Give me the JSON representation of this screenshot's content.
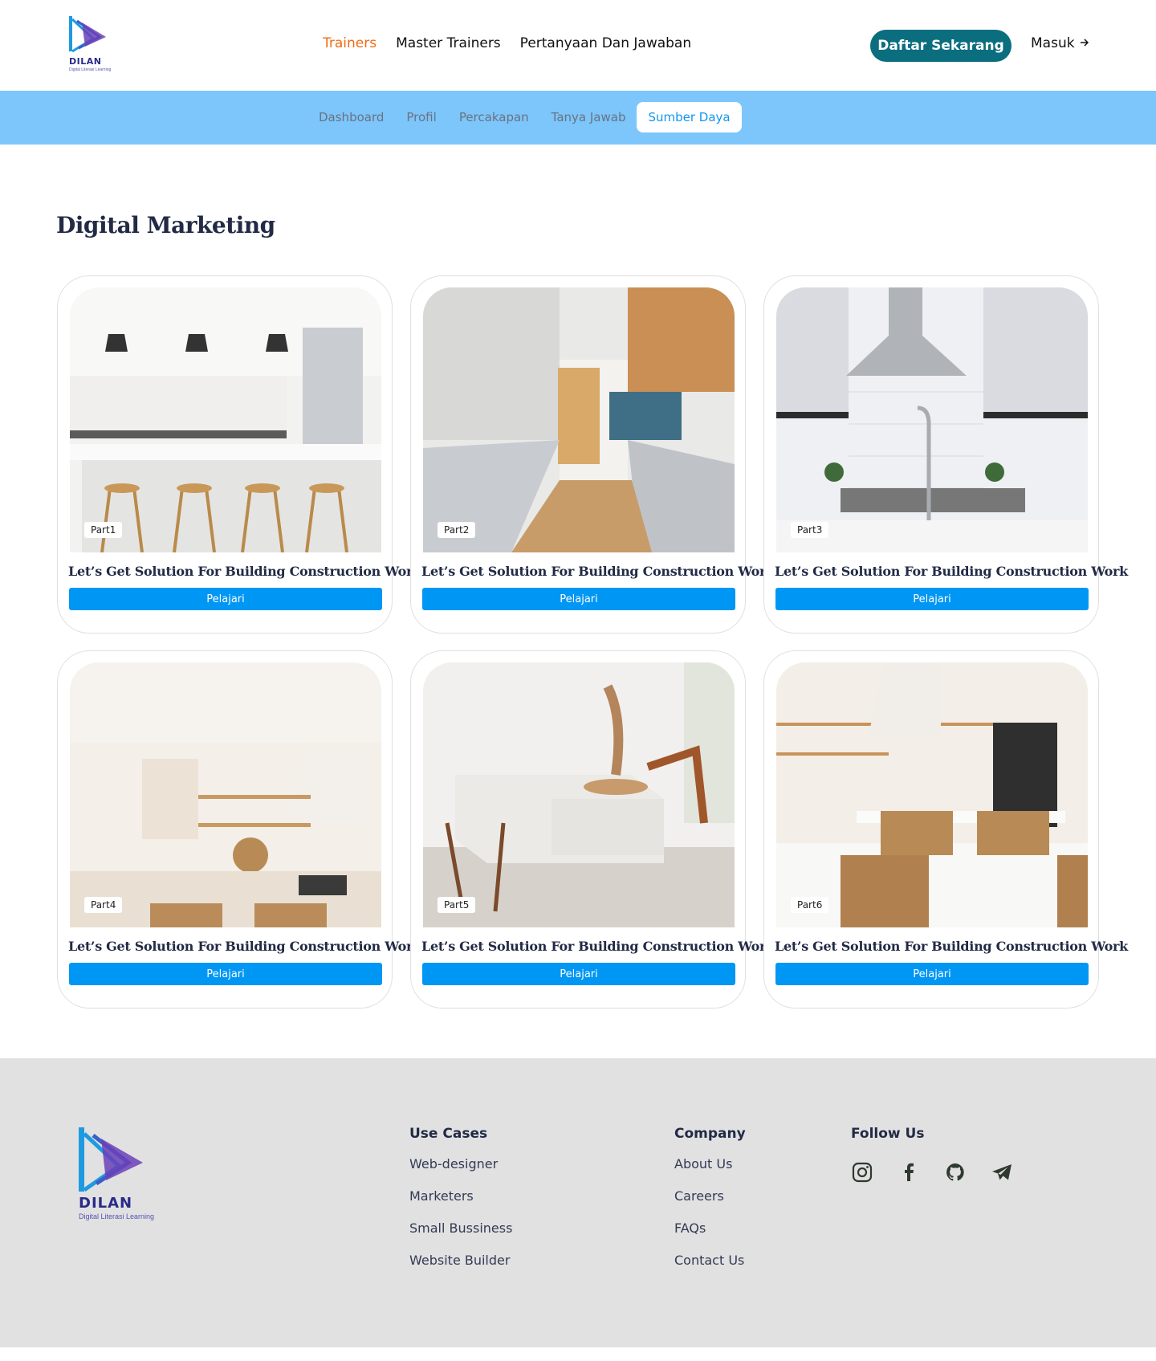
{
  "header": {
    "logo_word": "DILAN",
    "logo_sub": "Digital Literasi Learning",
    "nav": [
      {
        "label": "Trainers",
        "active": true
      },
      {
        "label": "Master Trainers",
        "active": false
      },
      {
        "label": "Pertanyaan Dan Jawaban",
        "active": false
      }
    ],
    "cta_label": "Daftar Sekarang",
    "login_label": "Masuk",
    "login_icon": "arrow-right-icon"
  },
  "subnav": {
    "items": [
      {
        "label": "Dashboard",
        "active": false
      },
      {
        "label": "Profil",
        "active": false
      },
      {
        "label": "Percakapan",
        "active": false
      },
      {
        "label": "Tanya Jawab",
        "active": false
      },
      {
        "label": "Sumber Daya",
        "active": true
      }
    ]
  },
  "main": {
    "title": "Digital Marketing",
    "cards": [
      {
        "part": "Part1",
        "title": "Let’s Get Solution For Building Construction Work",
        "button": "Pelajari",
        "image": "kitchen-with-stools"
      },
      {
        "part": "Part2",
        "title": "Let’s Get Solution For Building Construction Work",
        "button": "Pelajari",
        "image": "galley-kitchen"
      },
      {
        "part": "Part3",
        "title": "Let’s Get Solution For Building Construction Work",
        "button": "Pelajari",
        "image": "kitchen-faucet"
      },
      {
        "part": "Part4",
        "title": "Let’s Get Solution For Building Construction Work",
        "button": "Pelajari",
        "image": "cream-kitchen"
      },
      {
        "part": "Part5",
        "title": "Let’s Get Solution For Building Construction Work",
        "button": "Pelajari",
        "image": "living-room"
      },
      {
        "part": "Part6",
        "title": "Let’s Get Solution For Building Construction Work",
        "button": "Pelajari",
        "image": "kitchen-island"
      }
    ]
  },
  "footer": {
    "logo_word": "DILAN",
    "logo_sub": "Digital Literasi Learning",
    "use_cases": {
      "heading": "Use Cases",
      "links": [
        "Web-designer",
        "Marketers",
        "Small Bussiness",
        "Website Builder"
      ]
    },
    "company": {
      "heading": "Company",
      "links": [
        "About Us",
        "Careers",
        "FAQs",
        "Contact Us"
      ]
    },
    "follow": {
      "heading": "Follow Us",
      "icons": [
        "instagram-icon",
        "facebook-icon",
        "github-icon",
        "telegram-icon"
      ]
    }
  },
  "colors": {
    "accent": "#f26a13",
    "cta": "#0b6e7f",
    "subnav_bg": "#7cc6fb",
    "button": "#0096f4",
    "footer_bg": "#e1e1e1"
  }
}
